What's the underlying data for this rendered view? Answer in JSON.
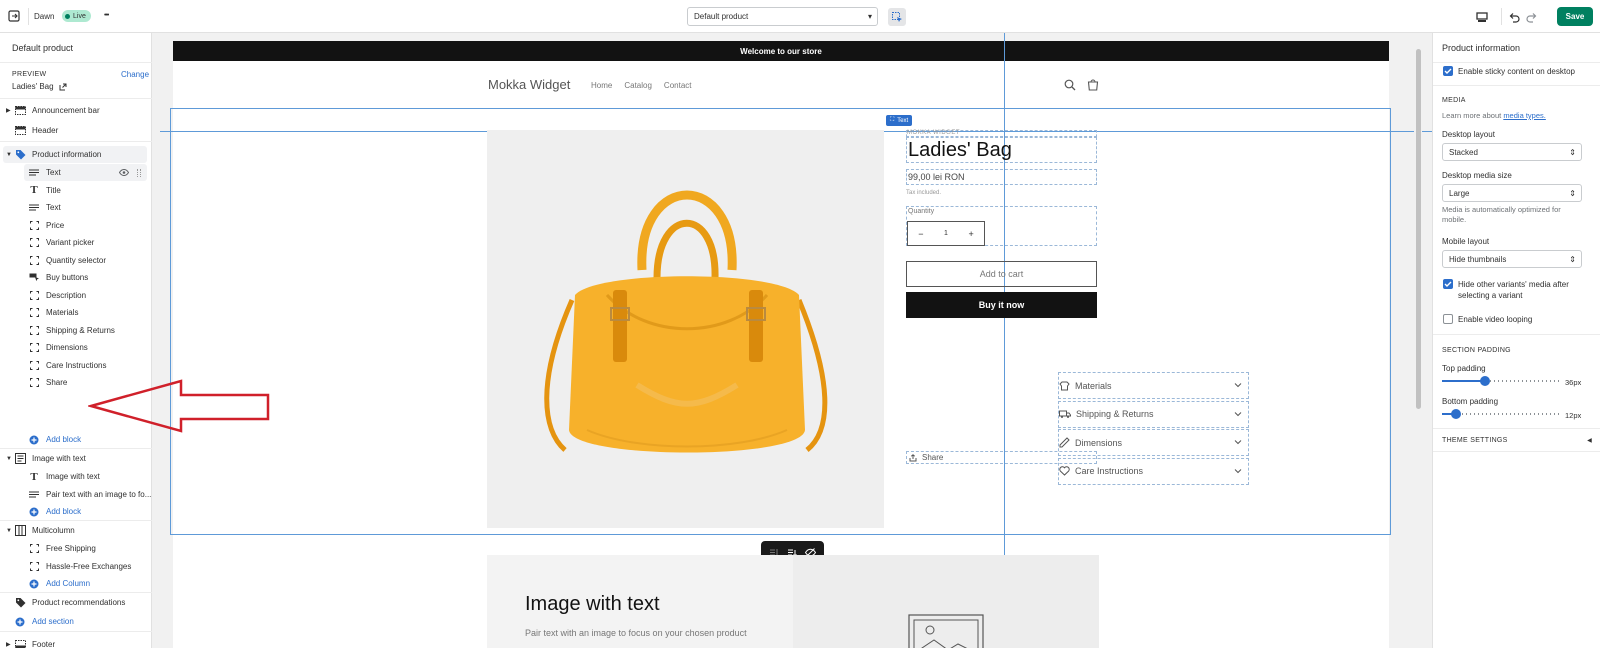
{
  "topbar": {
    "theme_name": "Dawn",
    "live_badge": "Live",
    "more_label": "•••",
    "template_select": "Default product",
    "save_label": "Save",
    "colors": {
      "save_bg": "#008060",
      "live_bg": "#aee9d1"
    }
  },
  "left": {
    "title": "Default product",
    "preview_label": "PREVIEW",
    "change_link": "Change",
    "preview_product": "Ladies' Bag",
    "announcement_bar": "Announcement bar",
    "header": "Header",
    "product_information": "Product information",
    "blocks": [
      {
        "label": "Text",
        "icon": "text-icon"
      },
      {
        "label": "Title",
        "icon": "title-icon"
      },
      {
        "label": "Text",
        "icon": "text-icon"
      },
      {
        "label": "Price",
        "icon": "block-icon"
      },
      {
        "label": "Variant picker",
        "icon": "block-icon"
      },
      {
        "label": "Quantity selector",
        "icon": "block-icon"
      },
      {
        "label": "Buy buttons",
        "icon": "buy-icon"
      },
      {
        "label": "Description",
        "icon": "block-icon"
      },
      {
        "label": "Materials",
        "icon": "block-icon"
      },
      {
        "label": "Shipping & Returns",
        "icon": "block-icon"
      },
      {
        "label": "Dimensions",
        "icon": "block-icon"
      },
      {
        "label": "Care Instructions",
        "icon": "block-icon"
      },
      {
        "label": "Share",
        "icon": "block-icon"
      }
    ],
    "add_block": "Add block",
    "image_with_text": "Image with text",
    "iwt_blocks": [
      "Image with text",
      "Pair text with an image to fo..."
    ],
    "add_block_2": "Add block",
    "multicolumn": "Multicolumn",
    "mc_blocks": [
      "Free Shipping",
      "Hassle-Free Exchanges"
    ],
    "add_column": "Add Column",
    "product_recommendations": "Product recommendations",
    "add_section": "Add section",
    "footer": "Footer"
  },
  "preview": {
    "announcement": "Welcome to our store",
    "store_name": "Mokka Widget",
    "nav": [
      "Home",
      "Catalog",
      "Contact"
    ],
    "text_tag": "Text",
    "vendor": "MOKKA WIDGET",
    "product_title": "Ladies' Bag",
    "price": "99,00 lei RON",
    "tax_note": "Tax included.",
    "quantity_label": "Quantity",
    "qty_minus": "−",
    "qty_value": "1",
    "qty_plus": "+",
    "add_to_cart": "Add to cart",
    "buy_now": "Buy it now",
    "accordions": [
      "Materials",
      "Shipping & Returns",
      "Dimensions",
      "Care Instructions"
    ],
    "share": "Share",
    "iwt_heading": "Image with text",
    "iwt_body": "Pair text with an image to focus on your chosen product"
  },
  "right": {
    "title": "Product information",
    "sticky_label": "Enable sticky content on desktop",
    "media_head": "MEDIA",
    "media_learn": "Learn more about",
    "media_link": "media types.",
    "desktop_layout_label": "Desktop layout",
    "desktop_layout_value": "Stacked",
    "desktop_media_size_label": "Desktop media size",
    "desktop_media_size_value": "Large",
    "media_note": "Media is automatically optimized for mobile.",
    "mobile_layout_label": "Mobile layout",
    "mobile_layout_value": "Hide thumbnails",
    "hide_variants_label": "Hide other variants' media after selecting a variant",
    "video_looping_label": "Enable video looping",
    "section_padding_head": "SECTION PADDING",
    "top_padding_label": "Top padding",
    "top_padding_value": "36px",
    "top_padding_fraction": 0.36,
    "bottom_padding_label": "Bottom padding",
    "bottom_padding_value": "12px",
    "bottom_padding_fraction": 0.12,
    "theme_settings": "THEME SETTINGS"
  }
}
